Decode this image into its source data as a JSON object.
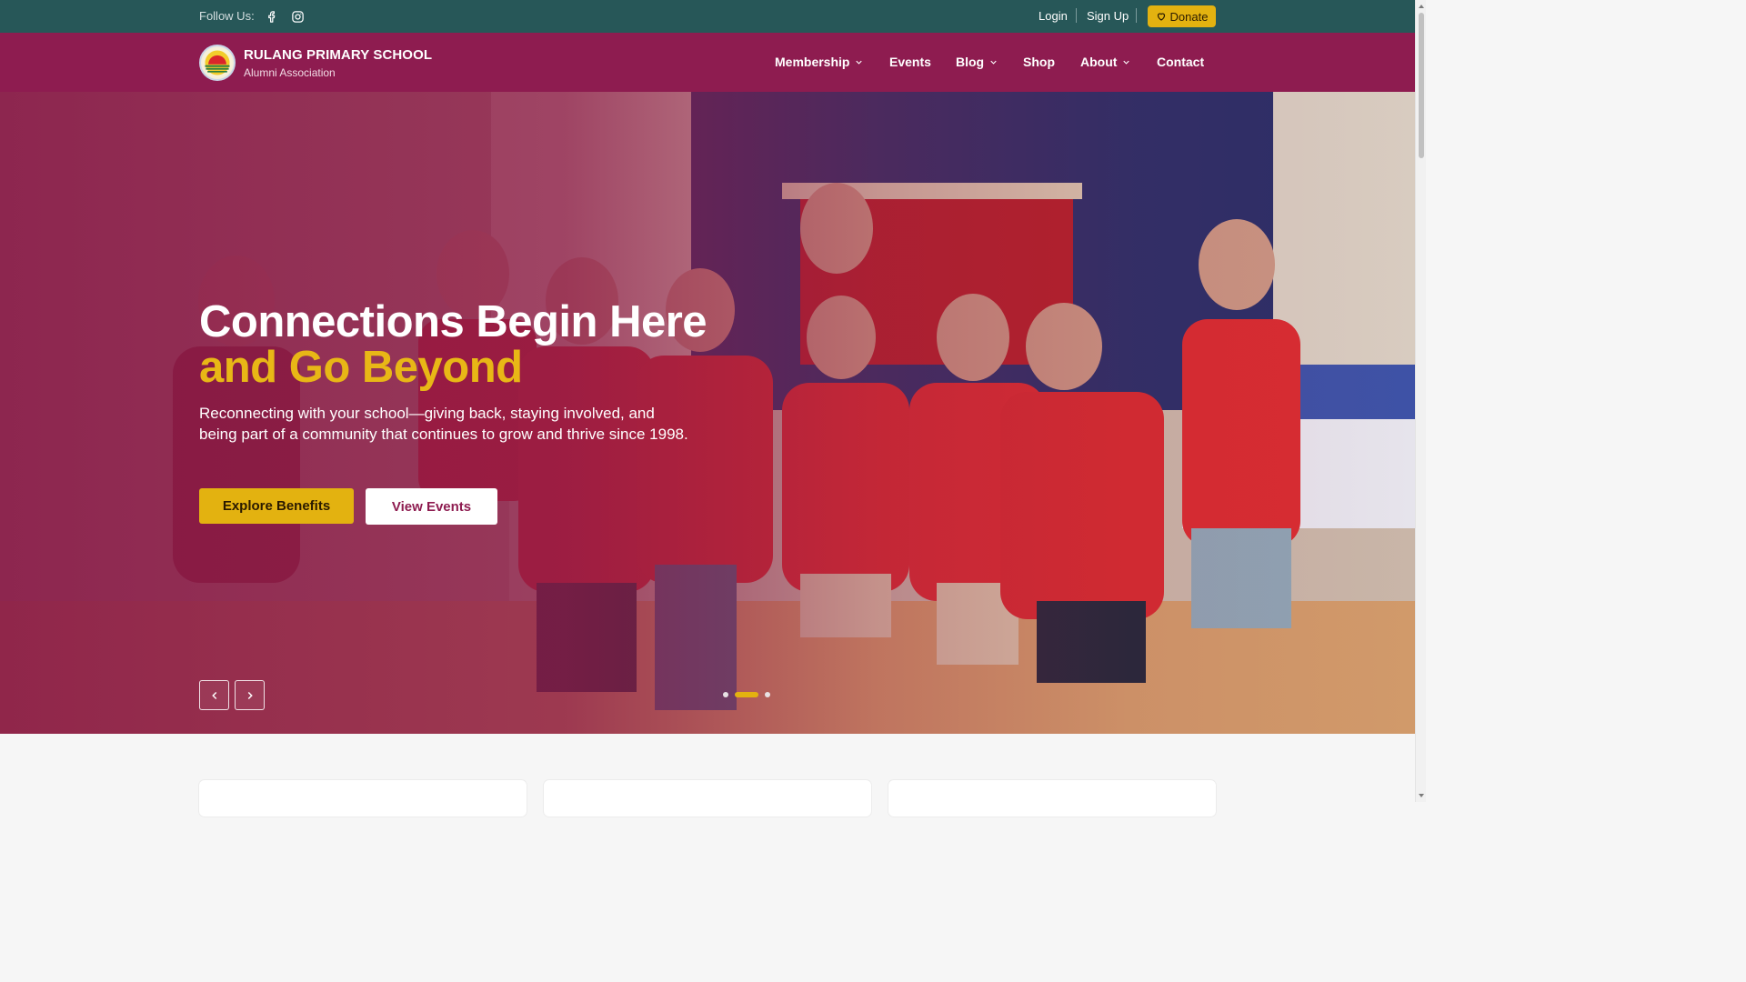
{
  "topbar": {
    "follow_label": "Follow Us:",
    "social": [
      "facebook-icon",
      "instagram-icon"
    ],
    "login": "Login",
    "signup": "Sign Up",
    "donate": "Donate"
  },
  "brand": {
    "title": "RULANG PRIMARY SCHOOL",
    "subtitle": "Alumni Association"
  },
  "nav": {
    "items": [
      {
        "label": "Membership",
        "dropdown": true
      },
      {
        "label": "Events",
        "dropdown": false
      },
      {
        "label": "Blog",
        "dropdown": true
      },
      {
        "label": "Shop",
        "dropdown": false
      },
      {
        "label": "About",
        "dropdown": true
      },
      {
        "label": "Contact",
        "dropdown": false
      }
    ]
  },
  "hero": {
    "headline_line1": "Connections Begin Here",
    "headline_line2": "and Go Beyond",
    "lede": "Reconnecting with your school—giving back, staying involved, and being part of a community that continues to grow and thrive since 1998.",
    "primary_cta": "Explore Benefits",
    "secondary_cta": "View Events",
    "slides_total": 3,
    "active_slide": 2
  },
  "colors": {
    "topbar": "#275758",
    "navbar": "#8e1c50",
    "accent": "#e3b210"
  }
}
